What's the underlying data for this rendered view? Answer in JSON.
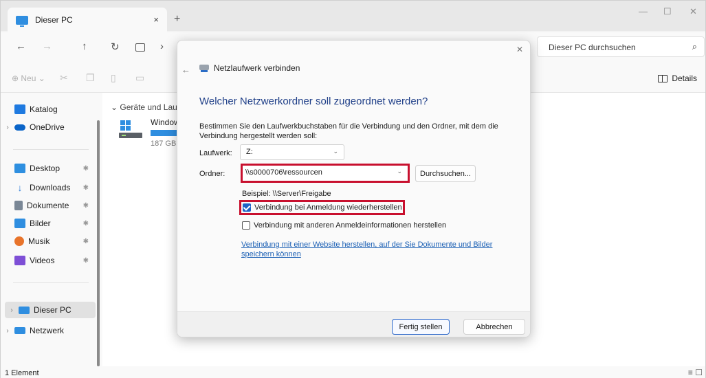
{
  "explorer": {
    "tab_title": "Dieser PC",
    "tab_close": "×",
    "tab_add": "+",
    "window_controls": {
      "minimize": "—",
      "maximize": "☐",
      "close": "✕"
    },
    "nav": {
      "back": "←",
      "forward": "→",
      "up": "↑",
      "refresh": "↻",
      "chevron": "›"
    },
    "search_placeholder": "Dieser PC durchsuchen",
    "command_bar": {
      "new_label": "Neu",
      "details_label": "Details"
    },
    "sidebar": {
      "items": [
        {
          "label": "Katalog",
          "icon": "gallery-icon",
          "color": "#1f7ae0"
        },
        {
          "label": "OneDrive",
          "icon": "onedrive-icon",
          "color": "#0a64c8"
        },
        {
          "label": "Desktop",
          "icon": "desktop-icon",
          "color": "#2e8fe0"
        },
        {
          "label": "Downloads",
          "icon": "downloads-icon",
          "color": "#2a7ad8"
        },
        {
          "label": "Dokumente",
          "icon": "documents-icon",
          "color": "#7a8796"
        },
        {
          "label": "Bilder",
          "icon": "pictures-icon",
          "color": "#2f8ee0"
        },
        {
          "label": "Musik",
          "icon": "music-icon",
          "color": "#e8742b"
        },
        {
          "label": "Videos",
          "icon": "videos-icon",
          "color": "#7e4fd6"
        },
        {
          "label": "Dieser PC",
          "icon": "this-pc-icon",
          "color": "#2f8ee0"
        },
        {
          "label": "Netzwerk",
          "icon": "network-icon",
          "color": "#2f8ee0"
        }
      ]
    },
    "content": {
      "group_header": "Geräte und Laufw",
      "drive_name": "Window",
      "drive_size": "187 GB"
    },
    "status_text": "1 Element"
  },
  "dialog": {
    "close": "✕",
    "back": "←",
    "title": "Netzlaufwerk verbinden",
    "heading": "Welcher Netzwerkordner soll zugeordnet werden?",
    "description": "Bestimmen Sie den Laufwerkbuchstaben für die Verbindung und den Ordner, mit dem die Verbindung hergestellt werden soll:",
    "drive_label": "Laufwerk:",
    "drive_value": "Z:",
    "folder_label": "Ordner:",
    "folder_value": "\\\\s0000706\\ressourcen",
    "browse_button": "Durchsuchen...",
    "example": "Beispiel: \\\\Server\\Freigabe",
    "reconnect_label": "Verbindung bei Anmeldung wiederherstellen",
    "reconnect_checked": true,
    "other_credentials_label": "Verbindung mit anderen Anmeldeinformationen herstellen",
    "other_credentials_checked": false,
    "website_link": "Verbindung mit einer Website herstellen, auf der Sie Dokumente und Bilder speichern können",
    "finish_button": "Fertig stellen",
    "cancel_button": "Abbrechen",
    "highlight_color": "#c8102e",
    "heading_color": "#1f3f88"
  }
}
